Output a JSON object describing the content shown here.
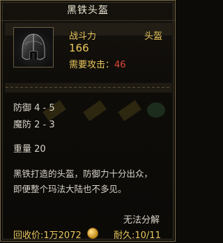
{
  "tooltip": {
    "title": "黑铁头盔",
    "item_icon": "helmet-icon",
    "combat_power_label": "战斗力",
    "combat_power_value": "166",
    "slot_type": "头盔",
    "required_attack_label": "需要攻击：",
    "required_attack_value": "46",
    "defense": "防御 4 - 5",
    "magic_defense": "魔防 2 - 3",
    "weight": "重量 20",
    "description_line1": "黑铁打造的头盔，防御力十分出众，",
    "description_line2": "即便整个玛法大陆也不多见。",
    "cannot_decompose": "无法分解",
    "recycle_price_label": "回收价:",
    "recycle_price_value": "1万2072",
    "durability": "耐久:10/11"
  },
  "colors": {
    "gold": "#e9c75d",
    "red": "#e2463a",
    "title": "#f1ead8"
  }
}
